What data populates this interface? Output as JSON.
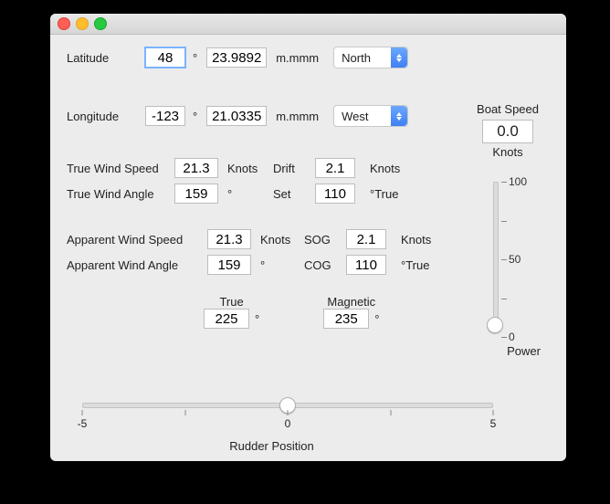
{
  "position": {
    "latitude": {
      "label": "Latitude",
      "deg": "48",
      "min": "23.9892",
      "deg_symbol": "°",
      "min_unit": "m.mmm",
      "hemi": "North"
    },
    "longitude": {
      "label": "Longitude",
      "deg": "-123",
      "min": "21.0335",
      "deg_symbol": "°",
      "min_unit": "m.mmm",
      "hemi": "West"
    }
  },
  "boat_speed": {
    "title": "Boat Speed",
    "value": "0.0",
    "unit": "Knots"
  },
  "true_wind": {
    "speed": {
      "label": "True Wind Speed",
      "value": "21.3",
      "unit": "Knots"
    },
    "angle": {
      "label": "True Wind Angle",
      "value": "159",
      "unit": "°"
    }
  },
  "current": {
    "drift": {
      "label": "Drift",
      "value": "2.1",
      "unit": "Knots"
    },
    "set": {
      "label": "Set",
      "value": "110",
      "unit": "°True"
    }
  },
  "apparent_wind": {
    "speed": {
      "label": "Apparent Wind Speed",
      "value": "21.3",
      "unit": "Knots"
    },
    "angle": {
      "label": "Apparent Wind Angle",
      "value": "159",
      "unit": "°"
    }
  },
  "ground": {
    "sog": {
      "label": "SOG",
      "value": "2.1",
      "unit": "Knots"
    },
    "cog": {
      "label": "COG",
      "value": "110",
      "unit": "°True"
    }
  },
  "heading": {
    "true": {
      "label": "True",
      "value": "225",
      "unit": "°"
    },
    "magnetic": {
      "label": "Magnetic",
      "value": "235",
      "unit": "°"
    }
  },
  "rudder": {
    "caption": "Rudder Position",
    "value": 0,
    "ticks": [
      "-5",
      "0",
      "5"
    ]
  },
  "power": {
    "label": "Power",
    "value": 0,
    "ticks": [
      "100",
      "50",
      "0"
    ]
  }
}
